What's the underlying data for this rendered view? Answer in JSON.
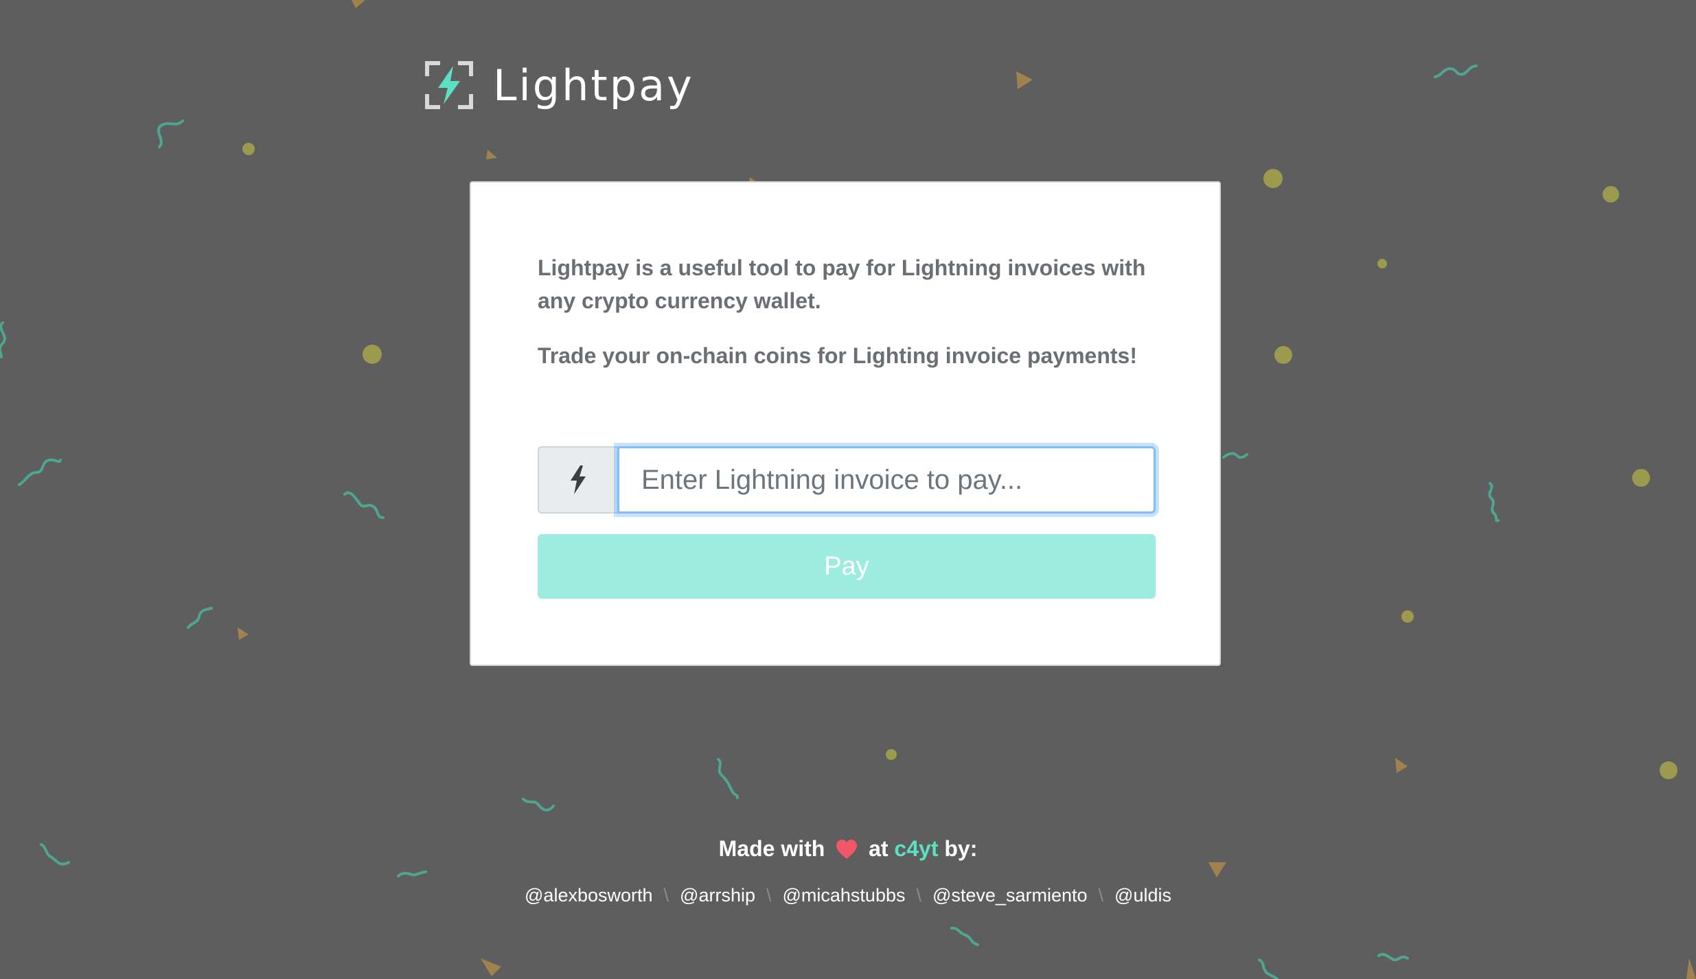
{
  "brand": {
    "name": "Lightpay",
    "icon": "lightning-scan-icon"
  },
  "card": {
    "intro_paragraph_1": "Lightpay is a useful tool to pay for Lightning invoices with any crypto currency wallet.",
    "intro_paragraph_2": "Trade your on-chain coins for Lighting invoice payments!",
    "invoice_input": {
      "placeholder": "Enter Lightning invoice to pay...",
      "value": "",
      "addon_icon": "lightning-bolt-icon"
    },
    "pay_button_label": "Pay"
  },
  "footer": {
    "made_with": "Made with",
    "heart_icon": "heart-icon",
    "at": "at",
    "org": "c4yt",
    "by": "by:",
    "contributors": [
      "@alexbosworth",
      "@arrship",
      "@micahstubbs",
      "@steve_sarmiento",
      "@uldis"
    ]
  },
  "colors": {
    "background": "#5e5e5e",
    "accent": "#5ce0c2",
    "pay_button": "#9cede0",
    "heart": "#f25767",
    "confetti_dot": "#9c9a4f",
    "confetti_triangle": "#a0824e",
    "confetti_squiggle": "#4fa58f"
  }
}
